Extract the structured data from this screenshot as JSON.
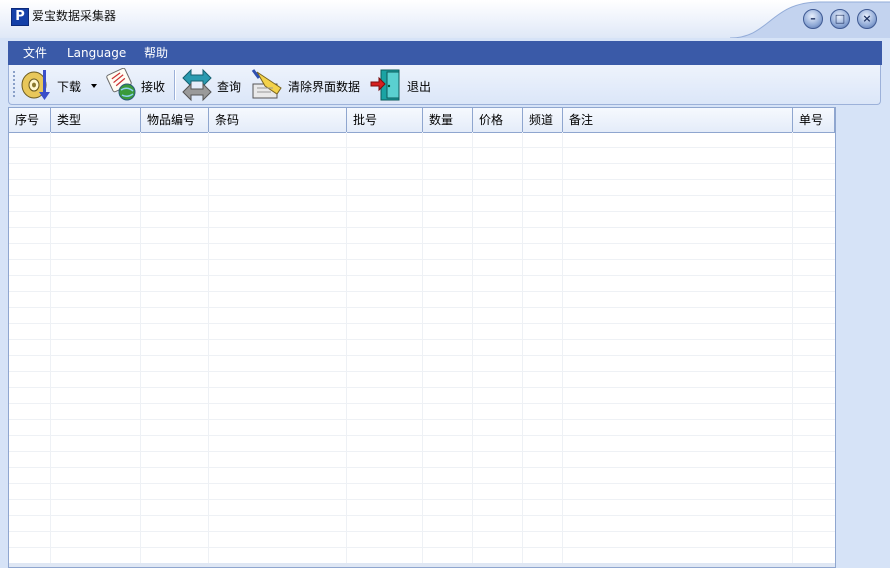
{
  "window": {
    "title": "爱宝数据采集器",
    "logo_letter": "P",
    "minimize_glyph": "–",
    "maximize_glyph": "□",
    "close_glyph": "×"
  },
  "menu": {
    "items": [
      {
        "label": "文件"
      },
      {
        "label": "Language"
      },
      {
        "label": "帮助"
      }
    ]
  },
  "toolbar": {
    "buttons": [
      {
        "label": "下载",
        "icon": "download-disc-icon",
        "has_dropdown": true
      },
      {
        "label": "接收",
        "icon": "receive-globe-icon"
      },
      {
        "label": "查询",
        "icon": "query-arrows-icon"
      },
      {
        "label": "清除界面数据",
        "icon": "clear-brush-icon"
      },
      {
        "label": "退出",
        "icon": "exit-door-icon"
      }
    ]
  },
  "table": {
    "columns": [
      "序号",
      "类型",
      "物品编号",
      "条码",
      "批号",
      "数量",
      "价格",
      "频道",
      "备注",
      "单号"
    ],
    "rows": []
  },
  "colors": {
    "menu_bg": "#3a5aa8",
    "window_bg": "#d6e3f7",
    "grid_border": "#8fa6cf"
  }
}
